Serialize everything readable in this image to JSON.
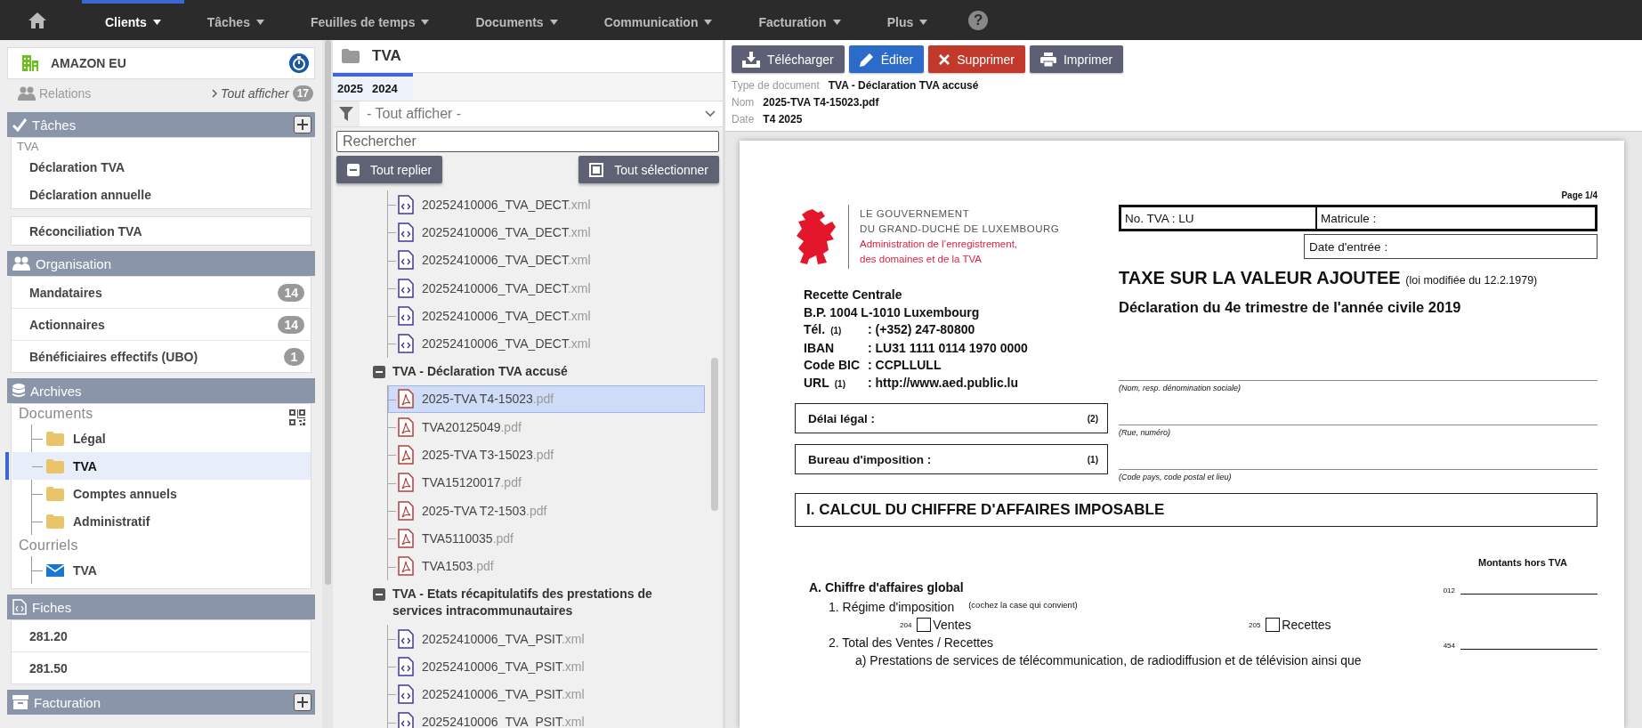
{
  "nav": {
    "items": [
      {
        "label": "Clients",
        "selected": true
      },
      {
        "label": "Tâches",
        "selected": false
      },
      {
        "label": "Feuilles de temps",
        "selected": false
      },
      {
        "label": "Documents",
        "selected": false
      },
      {
        "label": "Communication",
        "selected": false
      },
      {
        "label": "Facturation",
        "selected": false
      },
      {
        "label": "Plus",
        "selected": false
      }
    ],
    "help": "?"
  },
  "sidebar": {
    "client": {
      "name": "AMAZON EU"
    },
    "relations": {
      "label": "Relations",
      "disabled": true,
      "link": "Tout afficher",
      "count": "17"
    },
    "sections": [
      {
        "kind": "tasks",
        "title": "Tâches",
        "add": true,
        "cards": [
          {
            "group": "TVA",
            "items": [
              "Déclaration TVA",
              "Déclaration annuelle"
            ]
          },
          {
            "items": [
              "Réconciliation TVA"
            ]
          }
        ]
      },
      {
        "kind": "organisation",
        "title": "Organisation",
        "add": false,
        "items": [
          {
            "label": "Mandataires",
            "count": "14"
          },
          {
            "label": "Actionnaires",
            "count": "14"
          },
          {
            "label": "Bénéficiaires effectifs (UBO)",
            "count": "1"
          }
        ]
      },
      {
        "kind": "archives",
        "title": "Archives",
        "add": false,
        "trees": [
          {
            "label": "Documents",
            "children": [
              {
                "label": "Légal",
                "kind": "folder",
                "selected": false
              },
              {
                "label": "TVA",
                "kind": "folder",
                "selected": true
              },
              {
                "label": "Comptes annuels",
                "kind": "folder",
                "selected": false
              },
              {
                "label": "Administratif",
                "kind": "folder",
                "selected": false
              }
            ]
          },
          {
            "label": "Courriels",
            "children": [
              {
                "label": "TVA",
                "kind": "mail",
                "selected": false
              }
            ]
          }
        ]
      },
      {
        "kind": "forms",
        "title": "Fiches",
        "add": false,
        "items": [
          "281.20",
          "281.50"
        ]
      },
      {
        "kind": "billing",
        "title": "Facturation",
        "add": true
      }
    ]
  },
  "browser": {
    "title": "TVA",
    "tabs": [
      "2025",
      "2024"
    ],
    "filter": "- Tout afficher -",
    "search": {
      "placeholder": "Rechercher"
    },
    "buttons": [
      {
        "label": "Tout replier",
        "kind": "collapse"
      },
      {
        "label": "Tout sélectionner",
        "kind": "select"
      }
    ],
    "groups": [
      {
        "files": [
          {
            "name": "20252410006_TVA_DECT",
            "ext": ".xml",
            "kind": "xml",
            "selected": false
          },
          {
            "name": "20252410006_TVA_DECT",
            "ext": ".xml",
            "kind": "xml",
            "selected": false
          },
          {
            "name": "20252410006_TVA_DECT",
            "ext": ".xml",
            "kind": "xml",
            "selected": false
          },
          {
            "name": "20252410006_TVA_DECT",
            "ext": ".xml",
            "kind": "xml",
            "selected": false
          },
          {
            "name": "20252410006_TVA_DECT",
            "ext": ".xml",
            "kind": "xml",
            "selected": false
          },
          {
            "name": "20252410006_TVA_DECT",
            "ext": ".xml",
            "kind": "xml",
            "selected": false
          }
        ]
      },
      {
        "title": "TVA - Déclaration TVA accusé",
        "expanded": true,
        "files": [
          {
            "name": "2025-TVA T4-15023",
            "ext": ".pdf",
            "kind": "pdf",
            "selected": true
          },
          {
            "name": "TVA20125049",
            "ext": ".pdf",
            "kind": "pdf",
            "selected": false
          },
          {
            "name": "2025-TVA T3-15023",
            "ext": ".pdf",
            "kind": "pdf",
            "selected": false
          },
          {
            "name": "TVA15120017",
            "ext": ".pdf",
            "kind": "pdf",
            "selected": false
          },
          {
            "name": "2025-TVA T2-1503",
            "ext": ".pdf",
            "kind": "pdf",
            "selected": false
          },
          {
            "name": "TVA5110035",
            "ext": ".pdf",
            "kind": "pdf",
            "selected": false
          },
          {
            "name": "TVA1503",
            "ext": ".pdf",
            "kind": "pdf",
            "selected": false
          }
        ]
      },
      {
        "title": "TVA - Etats récapitulatifs des prestations de services intracommunautaires",
        "expanded": true,
        "files": [
          {
            "name": "20252410006_TVA_PSIT",
            "ext": ".xml",
            "kind": "xml",
            "selected": false
          },
          {
            "name": "20252410006_TVA_PSIT",
            "ext": ".xml",
            "kind": "xml",
            "selected": false
          },
          {
            "name": "20252410006_TVA_PSIT",
            "ext": ".xml",
            "kind": "xml",
            "selected": false
          },
          {
            "name": "20252410006_TVA_PSIT",
            "ext": ".xml",
            "kind": "xml",
            "selected": false
          }
        ]
      }
    ]
  },
  "viewer": {
    "actions": [
      {
        "label": "Télécharger",
        "kind": "download"
      },
      {
        "label": "Éditer",
        "kind": "edit"
      },
      {
        "label": "Supprimer",
        "kind": "delete"
      },
      {
        "label": "Imprimer",
        "kind": "print"
      }
    ],
    "meta": [
      {
        "label": "Type de document",
        "value": "TVA - Déclaration TVA accusé"
      },
      {
        "label": "Nom",
        "value": "2025-TVA T4-15023.pdf"
      },
      {
        "label": "Date",
        "value": "T4 2025"
      }
    ],
    "document": {
      "page": "Page 1/4",
      "gov": [
        "LE GOUVERNEMENT",
        "DU GRAND-DUCHÉ DE LUXEMBOURG"
      ],
      "admin": [
        "Administration de l’enregistrement,",
        "des domaines et de la TVA"
      ],
      "address_head": [
        "Recette Centrale",
        "B.P. 1004 L-1010 Luxembourg"
      ],
      "address": [
        {
          "label": "Tél.",
          "note": "(1)",
          "value": ": (+352) 247-80800"
        },
        {
          "label": "IBAN",
          "value": ": LU31 1111 0114 1970 0000"
        },
        {
          "label": "Code BIC",
          "value": ": CCPLLULL"
        },
        {
          "label": "URL",
          "note": "(1)",
          "value": ": http://www.aed.public.lu"
        }
      ],
      "left_boxes": [
        {
          "label": "Délai légal :",
          "note": "(2)"
        },
        {
          "label": "Bureau d'imposition :",
          "note": "(1)"
        }
      ],
      "vat_no": "No. TVA : LU",
      "matricule": "Matricule :",
      "entry_date": "Date d'entrée :",
      "title": "TAXE SUR LA VALEUR AJOUTEE",
      "title_note": "(loi modifiée du 12.2.1979)",
      "subtitle": "Déclaration du 4e trimestre de l'année civile 2019",
      "lines": [
        "(Nom, resp. dénomination sociale)",
        "(Rue, numéro)",
        "(Code pays, code postal et lieu)"
      ],
      "section": "I. CALCUL DU CHIFFRE D'AFFAIRES IMPOSABLE",
      "amounts": "Montants hors TVA",
      "a_mark": "A.",
      "a_title": "Chiffre d'affaires global",
      "a_code": "012",
      "item1": {
        "num": "1.",
        "label": "Régime d'imposition",
        "note": "(cochez la case qui convient)"
      },
      "checkboxes": [
        {
          "code": "204",
          "label": "Ventes",
          "checked": false
        },
        {
          "code": "205",
          "label": "Recettes",
          "checked": false
        }
      ],
      "item2": {
        "num": "2.",
        "label": "Total des Ventes / Recettes",
        "code": "454"
      },
      "item2a": {
        "num": "a)",
        "label": "Prestations de services de télécommunication, de radiodiffusion et de télévision ainsi que"
      }
    }
  }
}
